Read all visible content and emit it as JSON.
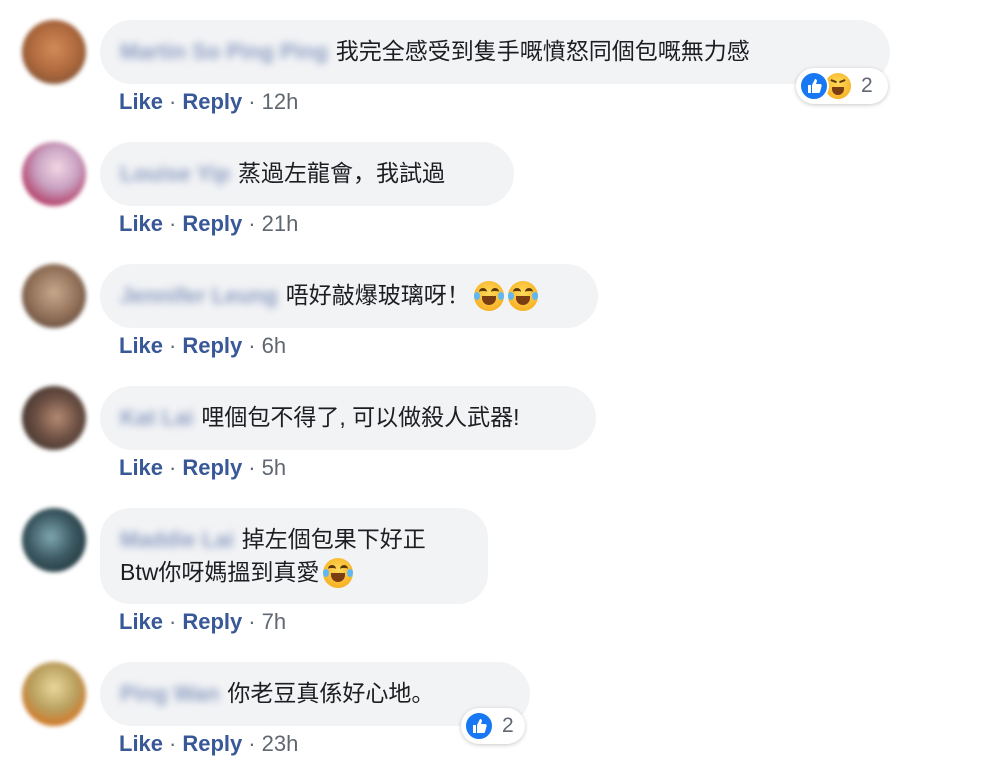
{
  "action_labels": {
    "like": "Like",
    "reply": "Reply",
    "sep": "·"
  },
  "comments": [
    {
      "author": "Martin So Ping Ping",
      "text": "我完全感受到隻手嘅憤怒同個包嘅無力感",
      "time": "12h",
      "reactions": {
        "icons": [
          "like-icon",
          "haha-icon"
        ],
        "count": "2"
      }
    },
    {
      "author": "Louise Yip",
      "text": "蒸過左龍會，我試過",
      "time": "21h"
    },
    {
      "author": "Jennifer Leung",
      "text": "唔好敲爆玻璃呀！",
      "emojis": [
        "tears-of-joy",
        "tears-of-joy"
      ],
      "time": "6h"
    },
    {
      "author": "Kat Lai",
      "text": "哩個包不得了, 可以做殺人武器!",
      "time": "5h"
    },
    {
      "author": "Maddie Lai",
      "text_line1": "掉左個包果下好正",
      "text_line2": "Btw你呀媽搵到真愛",
      "emojis": [
        "tears-of-joy"
      ],
      "time": "7h"
    },
    {
      "author": "Ping Wan",
      "text": "你老豆真係好心地。",
      "time": "23h",
      "reactions": {
        "icons": [
          "like-icon"
        ],
        "count": "2"
      }
    }
  ],
  "colors": {
    "link": "#385898",
    "bubble": "#f2f3f5",
    "meta": "#606770",
    "like_blue": "#1877f2"
  }
}
